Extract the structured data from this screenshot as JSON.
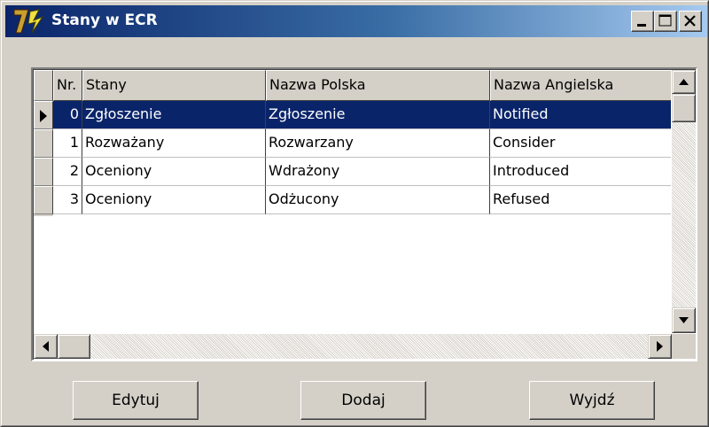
{
  "window": {
    "title": "Stany w ECR",
    "icon": "app-logo-icon",
    "controls": [
      "minimize-icon",
      "maximize-icon",
      "close-icon"
    ]
  },
  "grid": {
    "columns": [
      "Nr.",
      "Stany",
      "Nazwa Polska",
      "Nazwa Angielska"
    ],
    "rows": [
      {
        "nr": "0",
        "stany": "Zgłoszenie",
        "polska": "Zgłoszenie",
        "angielska": "Notified",
        "selected": true
      },
      {
        "nr": "1",
        "stany": "Rozważany",
        "polska": "Rozwarzany",
        "angielska": "Consider",
        "selected": false
      },
      {
        "nr": "2",
        "stany": "Oceniony",
        "polska": "Wdrażony",
        "angielska": "Introduced",
        "selected": false
      },
      {
        "nr": "3",
        "stany": "Oceniony",
        "polska": "Odżucony",
        "angielska": "Refused",
        "selected": false
      }
    ]
  },
  "buttons": {
    "edit": "Edytuj",
    "add": "Dodaj",
    "exit": "Wyjdź"
  },
  "colors": {
    "selection": "#0a246a",
    "title_start": "#0a246a",
    "title_end": "#a6caf0",
    "face": "#d4d0c8"
  }
}
